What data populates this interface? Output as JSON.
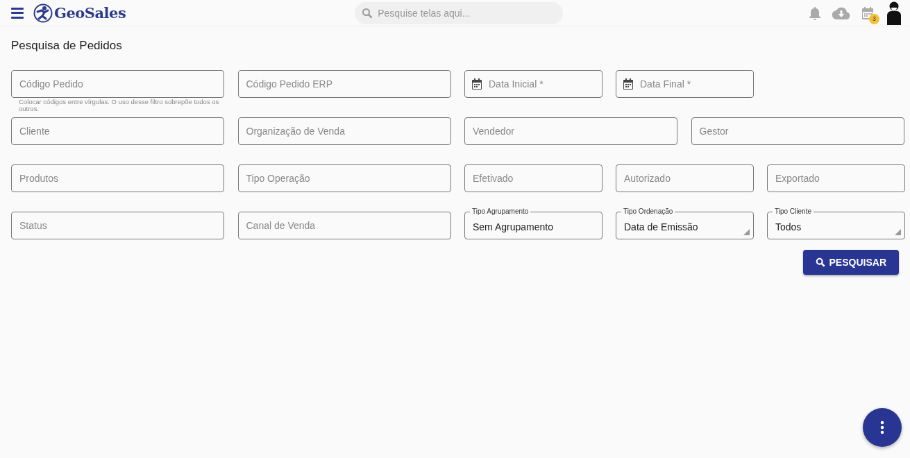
{
  "header": {
    "brand": "GeoSales",
    "search": {
      "placeholder": "Pesquise telas aqui..."
    },
    "calendar_badge": "3"
  },
  "page_title": "Pesquisa de Pedidos",
  "rows": [
    [
      {
        "kind": "text",
        "placeholder": "Código Pedido",
        "helper": "Colocar códigos entre vírgulas. O uso desse filtro sobrepõe todos os outros."
      },
      {
        "kind": "text",
        "placeholder": "Código Pedido ERP"
      },
      {
        "kind": "date",
        "placeholder": "Data Inicial *"
      },
      {
        "kind": "date",
        "placeholder": "Data Final *"
      }
    ],
    [
      {
        "kind": "text",
        "placeholder": "Cliente"
      },
      {
        "kind": "text",
        "placeholder": "Organização de Venda"
      },
      {
        "kind": "text",
        "placeholder": "Vendedor"
      },
      {
        "kind": "text",
        "placeholder": "Gestor"
      }
    ],
    [
      {
        "kind": "text",
        "placeholder": "Produtos"
      },
      {
        "kind": "text",
        "placeholder": "Tipo Operação"
      },
      {
        "kind": "text",
        "placeholder": "Efetivado"
      },
      {
        "kind": "text",
        "placeholder": "Autorizado"
      },
      {
        "kind": "text",
        "placeholder": "Exportado"
      }
    ],
    [
      {
        "kind": "text",
        "placeholder": "Status"
      },
      {
        "kind": "text",
        "placeholder": "Canal de Venda"
      },
      {
        "kind": "value",
        "label": "Tipo Agrupamento",
        "value": "Sem Agrupamento"
      },
      {
        "kind": "select",
        "label": "Tipo Ordenação",
        "value": "Data de Emissão"
      },
      {
        "kind": "select",
        "label": "Tipo Cliente",
        "value": "Todos"
      }
    ]
  ],
  "search_button": "PESQUISAR"
}
